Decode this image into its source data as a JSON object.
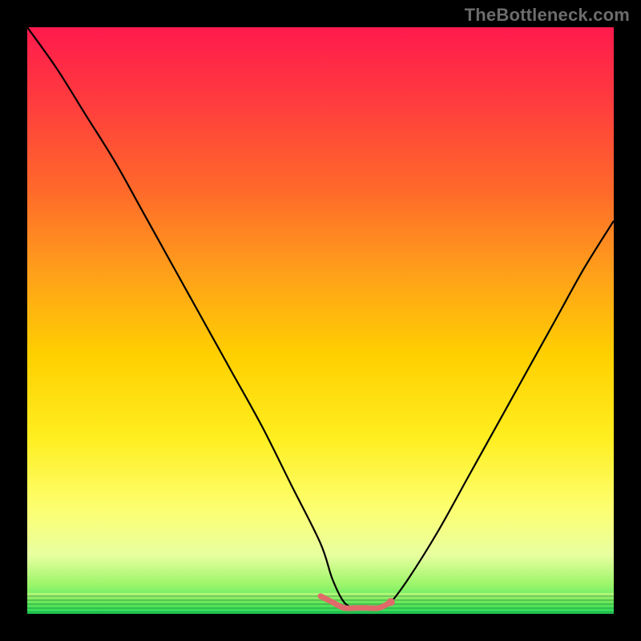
{
  "watermark": "TheBottleneck.com",
  "colors": {
    "frame": "#000000",
    "gradient_top": "#ff1a4d",
    "gradient_bottom": "#29e060",
    "curve_main": "#000000",
    "curve_highlight": "#e06a6a"
  },
  "chart_data": {
    "type": "line",
    "title": "",
    "xlabel": "",
    "ylabel": "",
    "xlim": [
      0,
      100
    ],
    "ylim": [
      0,
      100
    ],
    "series": [
      {
        "name": "bottleneck-curve",
        "x": [
          0,
          5,
          10,
          15,
          20,
          25,
          30,
          35,
          40,
          45,
          50,
          52,
          54,
          56,
          58,
          60,
          62,
          65,
          70,
          75,
          80,
          85,
          90,
          95,
          100
        ],
        "values": [
          100,
          93,
          85,
          77,
          68,
          59,
          50,
          41,
          32,
          22,
          12,
          6,
          2,
          1,
          1,
          1,
          2,
          6,
          14,
          23,
          32,
          41,
          50,
          59,
          67
        ]
      },
      {
        "name": "optimal-range-highlight",
        "x": [
          50,
          52,
          54,
          56,
          58,
          60,
          62
        ],
        "values": [
          3,
          2,
          1,
          1,
          1,
          1,
          2
        ]
      }
    ],
    "annotations": []
  }
}
